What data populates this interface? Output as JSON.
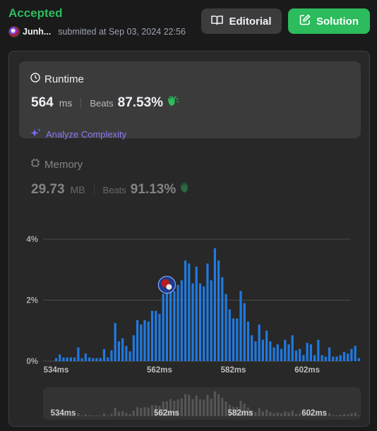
{
  "header": {
    "status": "Accepted",
    "submitter": "Junh...",
    "submitted_text": "submitted at Sep 03, 2024 22:56"
  },
  "buttons": {
    "editorial": "Editorial",
    "solution": "Solution"
  },
  "runtime": {
    "label": "Runtime",
    "value": "564",
    "unit": "ms",
    "beats_label": "Beats",
    "beats_value": "87.53%",
    "analyze_label": "Analyze Complexity"
  },
  "memory": {
    "label": "Memory",
    "value": "29.73",
    "unit": "MB",
    "beats_label": "Beats",
    "beats_value": "91.13%"
  },
  "colors": {
    "accepted": "#2cbb5d",
    "bar": "#1f7ae0",
    "accent_purple": "#8b7bf5",
    "clap": "#2cbb5d"
  },
  "chart_data": {
    "type": "bar",
    "x_start": 534,
    "x_step": 1,
    "x_unit": "ms",
    "values": [
      0.1,
      0.22,
      0.12,
      0.12,
      0.12,
      0.12,
      0.45,
      0.1,
      0.25,
      0.12,
      0.1,
      0.1,
      0.1,
      0.4,
      0.12,
      0.35,
      1.25,
      0.65,
      0.75,
      0.5,
      0.32,
      0.85,
      1.35,
      1.2,
      1.35,
      1.3,
      1.65,
      1.65,
      1.55,
      2.2,
      2.25,
      2.55,
      2.3,
      2.5,
      2.65,
      3.3,
      3.2,
      2.55,
      3.1,
      2.55,
      2.45,
      3.2,
      2.65,
      3.7,
      3.3,
      2.75,
      2.2,
      1.7,
      1.4,
      1.4,
      2.3,
      1.9,
      1.3,
      0.85,
      0.65,
      1.2,
      0.7,
      1.0,
      0.65,
      0.45,
      0.55,
      0.4,
      0.7,
      0.55,
      0.85,
      0.35,
      0.4,
      0.2,
      0.6,
      0.55,
      0.2,
      0.7,
      0.2,
      0.15,
      0.45,
      0.15,
      0.15,
      0.2,
      0.3,
      0.25,
      0.4,
      0.5,
      0.1
    ],
    "ytick_labels": [
      "4%",
      "2%",
      "0%"
    ],
    "yticks": [
      4,
      2,
      0
    ],
    "ylim": [
      0,
      4
    ],
    "xtick_labels": [
      "534ms",
      "562ms",
      "582ms",
      "602ms"
    ],
    "xticks": [
      534,
      562,
      582,
      602
    ],
    "highlight_x": 564,
    "grid": true
  }
}
